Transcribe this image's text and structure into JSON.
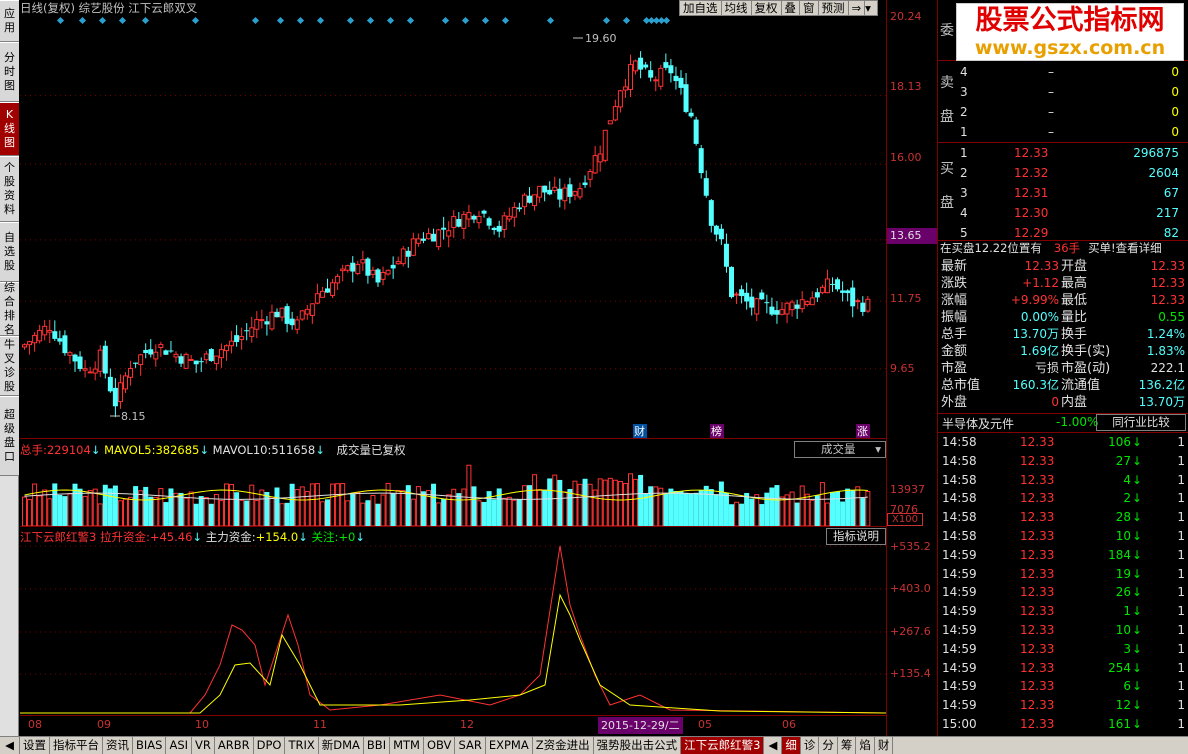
{
  "left_tabs": [
    "应用",
    "分时图",
    "K线图",
    "个股资料",
    "自选股",
    "综合排名",
    "牛叉诊股",
    "超级盘口"
  ],
  "header": {
    "title": "日线(复权) 综艺股份 江下云郎双叉"
  },
  "toolbar": [
    "加自选",
    "均线",
    "复权",
    "叠",
    "窗",
    "预测",
    "⇒"
  ],
  "price_labels": {
    "high": "19.60",
    "low": "8.15"
  },
  "price_axis": [
    "20.24",
    "18.13",
    "16.00",
    "13.65",
    "11.75",
    "9.65"
  ],
  "current_price_tag": "13.65",
  "event_markers": [
    "财",
    "榜",
    "涨"
  ],
  "vol_header": {
    "total_label": "总手:",
    "total": "229104",
    "mavol5_label": "MAVOL5:",
    "mavol5": "382685",
    "mavol10_label": "MAVOL10:",
    "mavol10": "511658",
    "note": "成交量已复权",
    "dropdown": "成交量"
  },
  "vol_axis": [
    "13937",
    "7076",
    "X100"
  ],
  "ind_header": {
    "name": "江下云郎红警3",
    "lsz_label": "拉升资金:",
    "lsz": "+45.46",
    "zl_label": "主力资金:",
    "zl": "+154.0",
    "gz_label": "关注:",
    "gz": "+0",
    "explain": "指标说明"
  },
  "ind_axis": [
    "+535.2",
    "+403.0",
    "+267.6",
    "+135.4"
  ],
  "time_axis": [
    "08",
    "09",
    "10",
    "11",
    "12",
    "05",
    "06"
  ],
  "date_tag": "2015-12-29/二",
  "orderbook": {
    "title": "委",
    "sell_label": [
      "卖",
      "盘"
    ],
    "buy_label": [
      "买",
      "盘"
    ],
    "sell": [
      [
        "4",
        "–",
        "0"
      ],
      [
        "3",
        "–",
        "0"
      ],
      [
        "2",
        "–",
        "0"
      ],
      [
        "1",
        "–",
        "0"
      ]
    ],
    "buy": [
      [
        "1",
        "12.33",
        "296875"
      ],
      [
        "2",
        "12.32",
        "2604"
      ],
      [
        "3",
        "12.31",
        "67"
      ],
      [
        "4",
        "12.30",
        "217"
      ],
      [
        "5",
        "12.29",
        "82"
      ]
    ]
  },
  "buy_info": {
    "text": "在买盘12.22位置有",
    "qty": "36手",
    "link": "买单!查看详细"
  },
  "quote": [
    [
      "最新",
      "12.33",
      "开盘",
      "12.33"
    ],
    [
      "涨跌",
      "+1.12",
      "最高",
      "12.33"
    ],
    [
      "涨幅",
      "+9.99%",
      "最低",
      "12.33"
    ],
    [
      "振幅",
      "0.00%",
      "量比",
      "0.55"
    ],
    [
      "总手",
      "13.70万",
      "换手",
      "1.24%"
    ],
    [
      "金额",
      "1.69亿",
      "换手(实)",
      "1.83%"
    ],
    [
      "市盈",
      "亏损",
      "市盈(动)",
      "222.1"
    ],
    [
      "总市值",
      "160.3亿",
      "流通值",
      "136.2亿"
    ],
    [
      "外盘",
      "0",
      "内盘",
      "13.70万"
    ]
  ],
  "sector": {
    "name": "半导体及元件",
    "pct": "-1.00%",
    "btn": "同行业比较"
  },
  "ticks": [
    [
      "14:58",
      "12.33",
      "106",
      "1"
    ],
    [
      "14:58",
      "12.33",
      "27",
      "1"
    ],
    [
      "14:58",
      "12.33",
      "4",
      "1"
    ],
    [
      "14:58",
      "12.33",
      "2",
      "1"
    ],
    [
      "14:58",
      "12.33",
      "28",
      "1"
    ],
    [
      "14:58",
      "12.33",
      "10",
      "1"
    ],
    [
      "14:59",
      "12.33",
      "184",
      "1"
    ],
    [
      "14:59",
      "12.33",
      "19",
      "1"
    ],
    [
      "14:59",
      "12.33",
      "26",
      "1"
    ],
    [
      "14:59",
      "12.33",
      "1",
      "1"
    ],
    [
      "14:59",
      "12.33",
      "10",
      "1"
    ],
    [
      "14:59",
      "12.33",
      "3",
      "1"
    ],
    [
      "14:59",
      "12.33",
      "254",
      "1"
    ],
    [
      "14:59",
      "12.33",
      "6",
      "1"
    ],
    [
      "14:59",
      "12.33",
      "12",
      "1"
    ],
    [
      "15:00",
      "12.33",
      "161",
      "1"
    ]
  ],
  "bottom_tabs": [
    "设置",
    "指标平台",
    "资讯",
    "BIAS",
    "ASI",
    "VR",
    "ARBR",
    "DPO",
    "TRIX",
    "新DMA",
    "BBI",
    "MTM",
    "OBV",
    "SAR",
    "EXPMA",
    "Z资金进出",
    "强势股出击公式",
    "江下云郎红警3"
  ],
  "right_tabs": [
    "细",
    "诊",
    "分",
    "筹",
    "焰",
    "财"
  ],
  "logo": {
    "line1": "股票公式指标网",
    "line2": "www.gszx.com.cn"
  },
  "chart_data": {
    "type": "candlestick",
    "price_range": [
      8.15,
      19.6
    ],
    "volume_unit": "X100"
  }
}
